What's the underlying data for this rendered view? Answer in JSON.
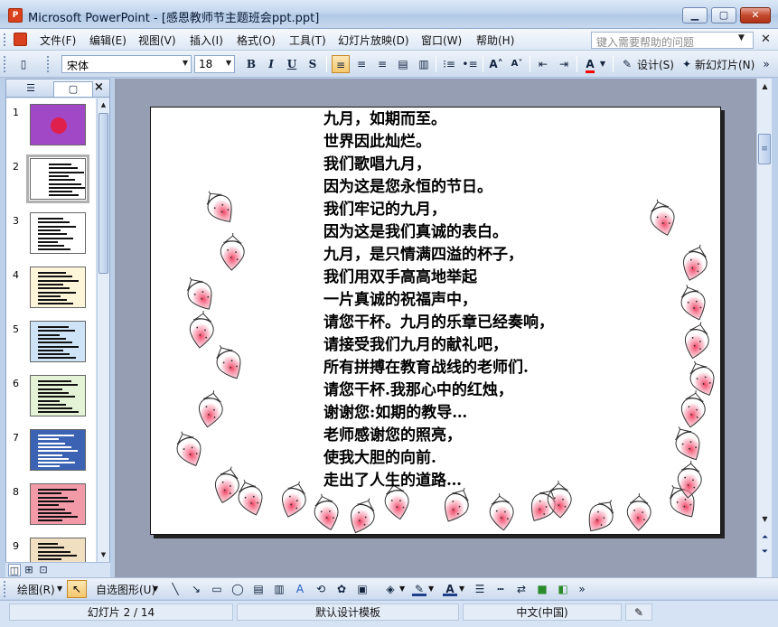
{
  "window": {
    "title": "Microsoft PowerPoint - [感恩教师节主题班会ppt.ppt]",
    "app_icon": "powerpoint-icon",
    "controls": [
      "minimize-icon",
      "maximize-icon",
      "close-icon"
    ]
  },
  "menu": {
    "items": [
      "文件(F)",
      "编辑(E)",
      "视图(V)",
      "插入(I)",
      "格式(O)",
      "工具(T)",
      "幻灯片放映(D)",
      "窗口(W)",
      "帮助(H)"
    ],
    "help_placeholder": "键入需要帮助的问题"
  },
  "toolbar": {
    "font_name": "宋体",
    "font_size": "18",
    "bold": "B",
    "italic": "I",
    "underline": "U",
    "shadow": "S",
    "font_color": "#ff0000",
    "design_label": "设计(S)",
    "new_slide_label": "新幻灯片(N)"
  },
  "left_pane": {
    "tab_outline_icon": "outline-icon",
    "tab_slides_icon": "slides-icon",
    "close_label": "×",
    "thumbnails": [
      {
        "num": "1",
        "bg": "#a048c6"
      },
      {
        "num": "2",
        "bg": "#ffffff"
      },
      {
        "num": "3",
        "bg": "#ffffff"
      },
      {
        "num": "4",
        "bg": "#fff6d9"
      },
      {
        "num": "5",
        "bg": "#cfe3f7"
      },
      {
        "num": "6",
        "bg": "#e4f3d5"
      },
      {
        "num": "7",
        "bg": "#3c62b4"
      },
      {
        "num": "8",
        "bg": "#f29aa8"
      },
      {
        "num": "9",
        "bg": "#f0dfc1"
      }
    ],
    "selected": "2"
  },
  "slide": {
    "lines": [
      "九月，如期而至。",
      "世界因此灿烂。",
      "我们歌唱九月，",
      "因为这是您永恒的节日。",
      "我们牢记的九月，",
      "因为这是我们真诚的表白。",
      "九月，是只情满四溢的杯子，",
      "我们用双手高高地举起",
      "一片真诚的祝福声中，",
      "请您干杯。九月的乐章已经奏响，",
      "请接受我们九月的献礼吧，",
      "所有拼搏在教育战线的老师们.",
      "请您干杯.我那心中的红烛，",
      "谢谢您:如期的教导…",
      "老师感谢您的照亮，",
      "使我大胆的向前.",
      "走出了人生的道路…"
    ],
    "decoration": "strawberry-icon"
  },
  "drawbar": {
    "draw_label": "绘图(R)",
    "autoshapes_label": "自选图形(U)"
  },
  "status": {
    "slide": "幻灯片 2 / 14",
    "design": "默认设计模板",
    "language": "中文(中国)"
  }
}
